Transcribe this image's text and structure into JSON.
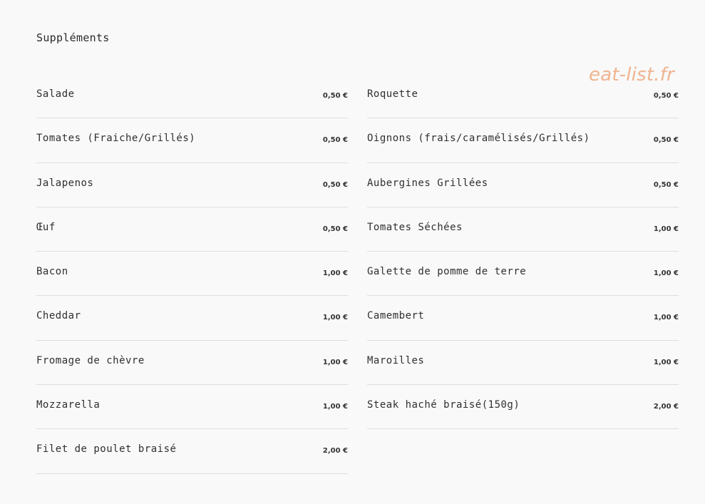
{
  "section": {
    "title": "Suppléments"
  },
  "watermark": {
    "text": "eat-list.fr",
    "color": "#f0b48e"
  },
  "menu": {
    "left": [
      {
        "name": "Salade",
        "price": "0,50 €"
      },
      {
        "name": "Tomates (Fraiche/Grillés)",
        "price": "0,50 €"
      },
      {
        "name": "Jalapenos",
        "price": "0,50 €"
      },
      {
        "name": "Œuf",
        "price": "0,50 €"
      },
      {
        "name": "Bacon",
        "price": "1,00 €"
      },
      {
        "name": "Cheddar",
        "price": "1,00 €"
      },
      {
        "name": "Fromage de chèvre",
        "price": "1,00 €"
      },
      {
        "name": "Mozzarella",
        "price": "1,00 €"
      },
      {
        "name": "Filet de poulet braisé",
        "price": "2,00 €"
      }
    ],
    "right": [
      {
        "name": "Roquette",
        "price": "0,50 €"
      },
      {
        "name": "Oignons (frais/caramélisés/Grillés)",
        "price": "0,50 €"
      },
      {
        "name": "Aubergines Grillées",
        "price": "0,50 €"
      },
      {
        "name": "Tomates Séchées",
        "price": "1,00 €"
      },
      {
        "name": "Galette de pomme de terre",
        "price": "1,00 €"
      },
      {
        "name": "Camembert",
        "price": "1,00 €"
      },
      {
        "name": "Maroilles",
        "price": "1,00 €"
      },
      {
        "name": "Steak haché braisé(150g)",
        "price": "2,00 €"
      }
    ]
  }
}
